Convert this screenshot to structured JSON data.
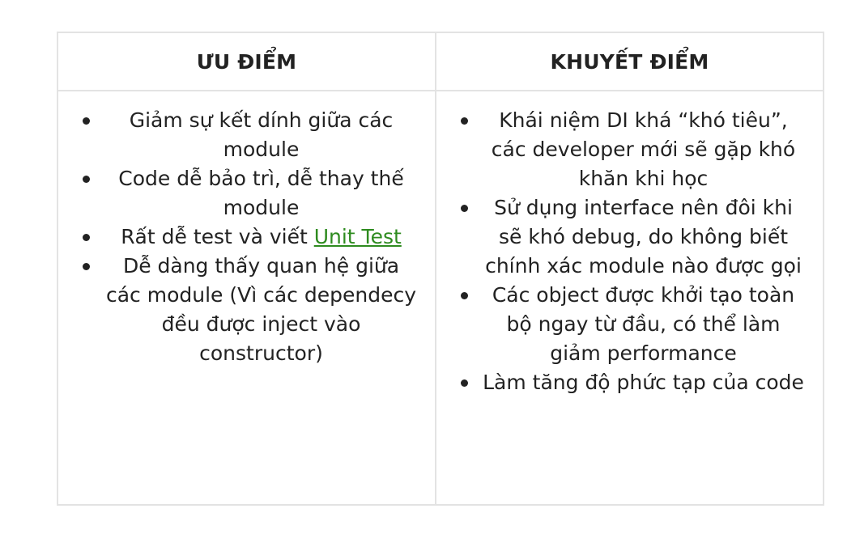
{
  "table": {
    "headers": {
      "pros": "ƯU ĐIỂM",
      "cons": "KHUYẾT ĐIỂM"
    },
    "pros": [
      {
        "text": "Giảm sự kết dính giữa các module"
      },
      {
        "text": "Code dễ bảo trì, dễ thay thế module"
      },
      {
        "text": "Rất dễ test và viết ",
        "link": "Unit Test"
      },
      {
        "text": "Dễ dàng thấy quan hệ giữa các module (Vì các dependecy đều được inject vào constructor)"
      }
    ],
    "cons": [
      {
        "text": "Khái niệm DI khá “khó tiêu”, các developer mới sẽ gặp khó khăn khi học"
      },
      {
        "text": "Sử dụng interface nên đôi khi sẽ khó debug, do không biết chính xác module nào được gọi"
      },
      {
        "text": "Các object được khởi tạo toàn bộ ngay từ đầu, có thể làm giảm performance"
      },
      {
        "text": "Làm tăng độ phức tạp của code"
      }
    ],
    "colors": {
      "border": "#e3e3e3",
      "text": "#222222",
      "link": "#2e8b1f"
    }
  }
}
